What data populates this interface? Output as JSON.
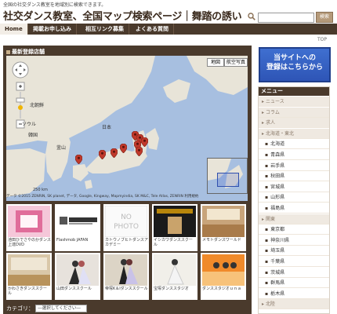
{
  "header": {
    "tagline": "全国の社交ダンス教室を地域別に検索できます。",
    "title": "社交ダンス教室、全国マップ検索ページ｜舞踏の誘い",
    "search": {
      "placeholder": "",
      "button_label": "検索"
    }
  },
  "nav": {
    "items": [
      "Home",
      "掲載お申し込み",
      "相互リンク募集",
      "よくある質問"
    ],
    "active": "Home"
  },
  "top_link": "TOP",
  "main": {
    "header": "最新登録店舗",
    "map": {
      "type_controls": [
        "地図",
        "航空写真"
      ],
      "labels": {
        "hokkaido": "北朝鮮",
        "korea": "韓国",
        "japan": "日本",
        "seoul": "ソウル",
        "busan": "釜山"
      },
      "scale": "250 km",
      "copyright": "データ ©2015 ZENRIN, SK planet, データ, Google, Kingway, Mapmyindia, SK M&C, Tele Atlas, ZENRIN 利用規約",
      "pin_count": 9
    },
    "shops": [
      {
        "caption": "池田ひでさやのかダンス上達DVD",
        "thumb": "dvd"
      },
      {
        "caption": "Flashmob JAFAN",
        "thumb": "flashmob"
      },
      {
        "caption": "カトウノブヒトダンスアカデミー",
        "thumb": "nophoto"
      },
      {
        "caption": "イシカワダンススクー ル",
        "thumb": "ishikawa"
      },
      {
        "caption": "メモトダンスワールド",
        "thumb": "hall"
      },
      {
        "caption": "かわさきダンススクー ル",
        "thumb": "studio"
      },
      {
        "caption": "山田ダンススクール",
        "thumb": "couple"
      },
      {
        "caption": "帝塚K＆Iダンススクール",
        "thumb": "couple2"
      },
      {
        "caption": "宝塚ダンススタジオ",
        "thumb": "solo"
      },
      {
        "caption": "ダンススタジオｕｎａ",
        "thumb": "group"
      }
    ],
    "category_label": "カテゴリ：",
    "category_select": "―選択してください―"
  },
  "banner": {
    "line1": "当サイトへの",
    "line2": "登録はこちらから"
  },
  "sidebar": {
    "header": "メニュー",
    "items": [
      {
        "label": "ニュース",
        "kind": "cat"
      },
      {
        "label": "コラム",
        "kind": "cat"
      },
      {
        "label": "求人",
        "kind": "cat"
      },
      {
        "label": "北海道・東北",
        "kind": "cat"
      },
      {
        "label": "北海道",
        "kind": "pref"
      },
      {
        "label": "青森県",
        "kind": "pref"
      },
      {
        "label": "岩手県",
        "kind": "pref"
      },
      {
        "label": "秋田県",
        "kind": "pref"
      },
      {
        "label": "宮城県",
        "kind": "pref"
      },
      {
        "label": "山形県",
        "kind": "pref"
      },
      {
        "label": "福島県",
        "kind": "pref"
      },
      {
        "label": "関東",
        "kind": "cat"
      },
      {
        "label": "東京都",
        "kind": "pref"
      },
      {
        "label": "神奈川県",
        "kind": "pref"
      },
      {
        "label": "埼玉県",
        "kind": "pref"
      },
      {
        "label": "千葉県",
        "kind": "pref"
      },
      {
        "label": "茨城県",
        "kind": "pref"
      },
      {
        "label": "群馬県",
        "kind": "pref"
      },
      {
        "label": "栃木県",
        "kind": "pref"
      },
      {
        "label": "北陸",
        "kind": "cat"
      }
    ]
  },
  "colors": {
    "brand_brown": "#4a3a2c",
    "banner_blue": "#2e55b6",
    "pin_red": "#c0392b"
  }
}
